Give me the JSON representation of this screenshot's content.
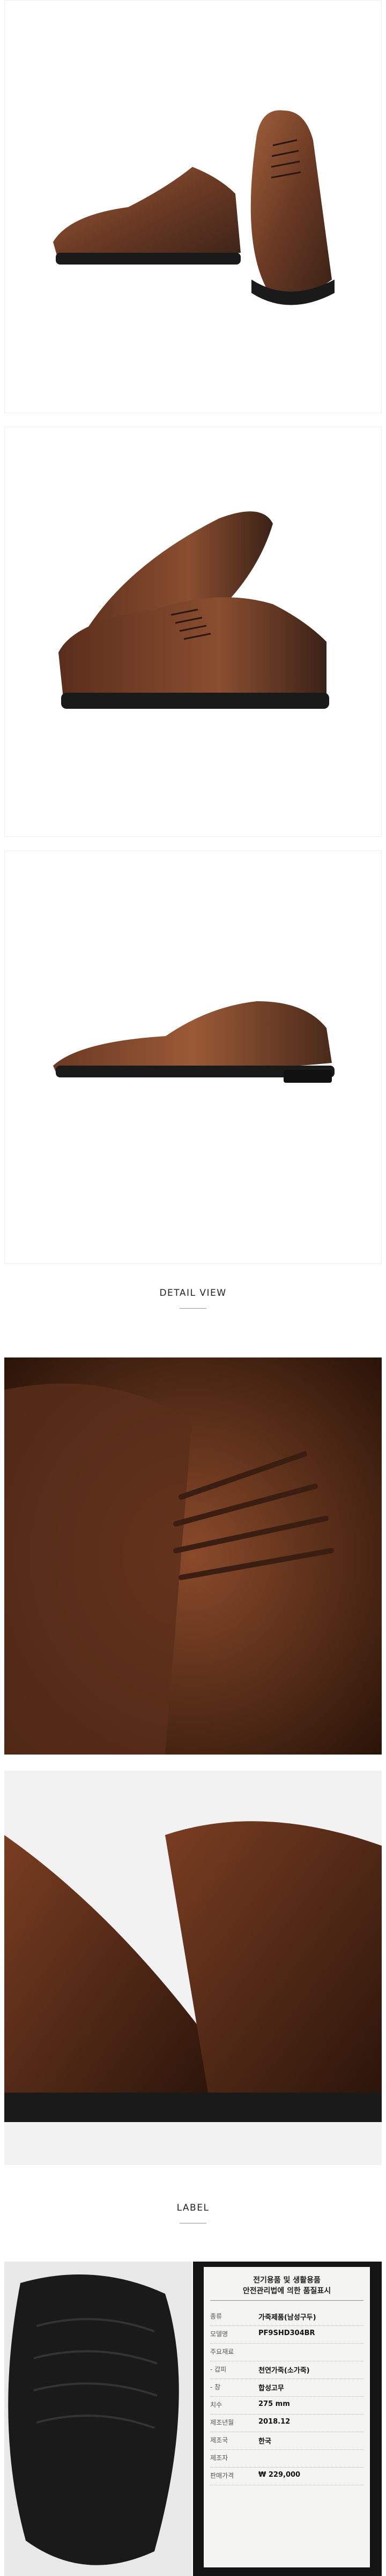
{
  "sections": {
    "detail_view": "DETAIL VIEW",
    "label": "LABEL"
  },
  "label_sheet": {
    "header_line1": "전기용품 및 생활용품",
    "header_line2": "안전관리법에 의한 품질표시",
    "rows": [
      {
        "key": "종류",
        "value": "가죽제품(남성구두)"
      },
      {
        "key": "모델명",
        "value": "PF9SHD304BR"
      },
      {
        "key": "주요재료",
        "value": ""
      },
      {
        "key": "- 갑피",
        "value": "천연가죽(소가죽)"
      },
      {
        "key": "- 창",
        "value": "합성고무"
      },
      {
        "key": "치수",
        "value": "275 mm"
      },
      {
        "key": "제조년월",
        "value": "2018.12"
      },
      {
        "key": "제조국",
        "value": "한국"
      },
      {
        "key": "제조자",
        "value": ""
      },
      {
        "key": "판매가격",
        "value": "₩ 229,000"
      }
    ]
  },
  "colors": {
    "leather_dark": "#3b2217",
    "leather_mid": "#6b3a24",
    "leather_light": "#a0603a",
    "sole": "#1a1a1a"
  }
}
